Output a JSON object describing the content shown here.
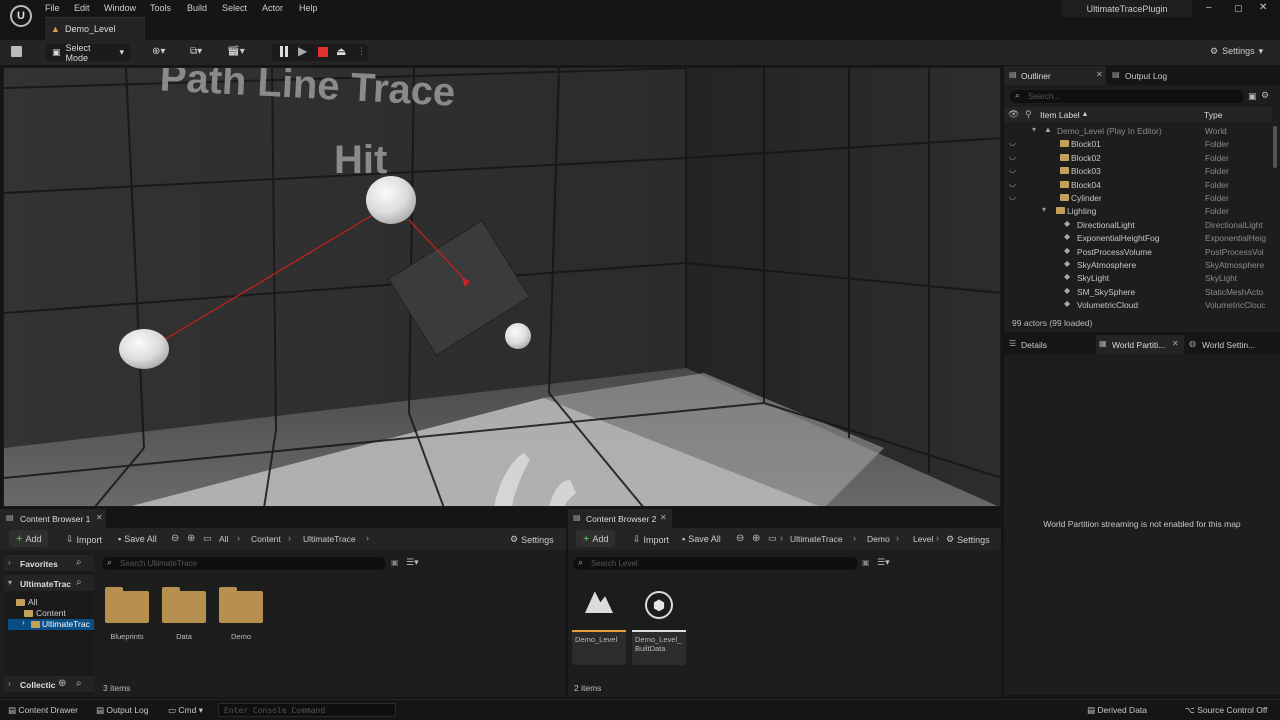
{
  "app": {
    "menus": [
      "File",
      "Edit",
      "Window",
      "Tools",
      "Build",
      "Select",
      "Actor",
      "Help"
    ],
    "plugin_title": "UltimateTracePlugin",
    "level_tab": "Demo_Level"
  },
  "toolbar": {
    "mode_label": "Select Mode",
    "settings_label": "Settings"
  },
  "viewport": {
    "text_line1": "Path Line Trace",
    "text_line2": "Hit"
  },
  "outliner": {
    "tab_outliner": "Outliner",
    "tab_output": "Output Log",
    "search_placeholder": "Search...",
    "col_label": "Item Label",
    "col_type": "Type",
    "rows": [
      {
        "label": "Demo_Level (Play In Editor)",
        "type": "World"
      },
      {
        "label": "Block01",
        "type": "Folder"
      },
      {
        "label": "Block02",
        "type": "Folder"
      },
      {
        "label": "Block03",
        "type": "Folder"
      },
      {
        "label": "Block04",
        "type": "Folder"
      },
      {
        "label": "Cylinder",
        "type": "Folder"
      },
      {
        "label": "Lighting",
        "type": "Folder"
      },
      {
        "label": "DirectionalLight",
        "type": "DirectionalLight"
      },
      {
        "label": "ExponentialHeightFog",
        "type": "ExponentialHeig"
      },
      {
        "label": "PostProcessVolume",
        "type": "PostProcessVol"
      },
      {
        "label": "SkyAtmosphere",
        "type": "SkyAtmosphere"
      },
      {
        "label": "SkyLight",
        "type": "SkyLight"
      },
      {
        "label": "SM_SkySphere",
        "type": "StaticMeshActo"
      },
      {
        "label": "VolumetricCloud",
        "type": "VolumetricClouc"
      }
    ],
    "count": "99 actors (99 loaded)"
  },
  "details": {
    "tab_details": "Details",
    "tab_wp": "World Partiti...",
    "tab_ws": "World Settin...",
    "message": "World Partition streaming is not enabled for this map"
  },
  "cb1": {
    "title": "Content Browser 1",
    "add": "Add",
    "import": "Import",
    "save_all": "Save All",
    "path": [
      "All",
      "Content",
      "UltimateTrace"
    ],
    "settings": "Settings",
    "favorites": "Favorites",
    "tree_root": "UltimateTrac",
    "tree_all": "All",
    "tree_content": "Content",
    "tree_ut": "UltimateTrac",
    "collections": "Collectic",
    "search_placeholder": "Search UltimateTrace",
    "items": [
      "Blueprints",
      "Data",
      "Demo"
    ],
    "count": "3 items"
  },
  "cb2": {
    "title": "Content Browser 2",
    "add": "Add",
    "import": "Import",
    "save_all": "Save All",
    "path": [
      "UltimateTrace",
      "Demo",
      "Level"
    ],
    "settings": "Settings",
    "search_placeholder": "Search Level",
    "items": [
      {
        "name": "Demo_Level",
        "accent": "#e0a040"
      },
      {
        "name": "Demo_Level_ BuiltData",
        "accent": "#e0e0e0"
      }
    ],
    "count": "2 items"
  },
  "status": {
    "content_drawer": "Content Drawer",
    "output_log": "Output Log",
    "cmd": "Cmd",
    "console_placeholder": "Enter Console Command",
    "derived": "Derived Data",
    "source": "Source Control Off"
  }
}
